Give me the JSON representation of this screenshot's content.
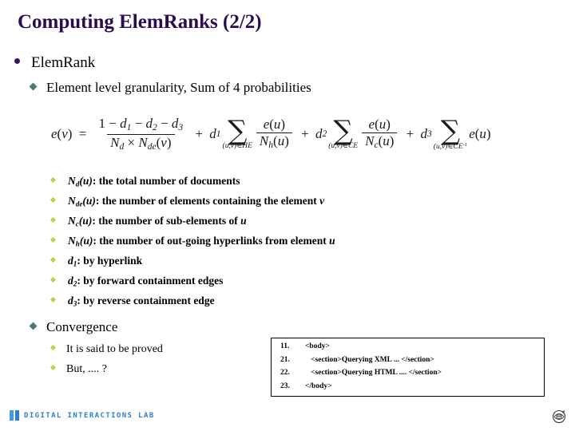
{
  "slide": {
    "title": "Computing ElemRanks (2/2)",
    "bullets": {
      "level1_a": "ElemRank",
      "level2_a": "Element level granularity, Sum of 4 probabilities",
      "level1_b": "Convergence"
    },
    "formula": {
      "lhs": "e(v)",
      "equals": "=",
      "term1_num": "1 − d₁ − d₂ − d₃",
      "term1_den": "Nₑ × Nₑₑ(v)",
      "term2_coef": "d₁",
      "term2_sum_sub": "(u,v)∈HE",
      "term2_num": "e(u)",
      "term2_den": "Nₕ(u)",
      "term3_coef": "d₂",
      "term3_sum_sub": "(u,v)∈CE",
      "term3_num": "e(u)",
      "term3_den": "Nₙ(u)",
      "term4_coef": "d₃",
      "term4_sum_sub": "(u,v)∈CE⁻¹",
      "term4_body": "e(u)"
    },
    "definitions": [
      "N_d(u): the total number of documents",
      "N_de(u): the number of elements containing the element v",
      "N_c(u): the number of sub-elements of u",
      "N_h(u): the number of out-going hyperlinks from element u",
      "d_1: by hyperlink",
      "d_2: by forward containment edges",
      "d_3: by reverse containment edge"
    ],
    "convergence_items": [
      "It is said to be proved",
      "But, .... ?"
    ],
    "code_box": {
      "lines": [
        {
          "number": "11.",
          "text": "<body>"
        },
        {
          "number": "21.",
          "text": "   <section>Querying XML ... </section>"
        },
        {
          "number": "22.",
          "text": "   <section>Querying HTML .... </section>"
        },
        {
          "number": "23.",
          "text": "</body>"
        }
      ]
    },
    "footer": {
      "logo_text": "DIGITAL INTERACTIONS LAB"
    },
    "colors": {
      "title": "#2b0b52",
      "bullet_level1": "#3b1060",
      "bullet_level2": "#4c7a77",
      "bullet_level3": "#c9c949",
      "logo_blue": "#2b7fd4"
    }
  }
}
